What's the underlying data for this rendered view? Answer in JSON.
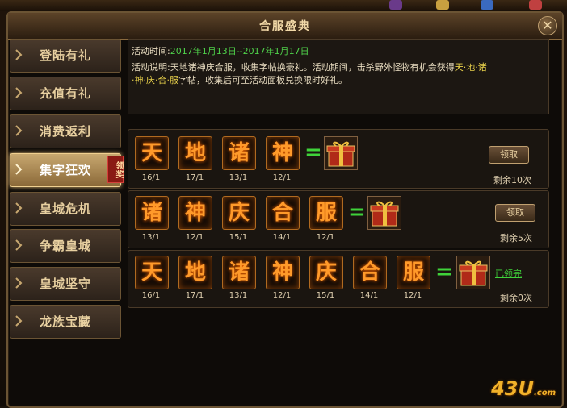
{
  "window": {
    "title": "合服盛典"
  },
  "sidebar": {
    "tabs": [
      {
        "label": "登陆有礼"
      },
      {
        "label": "充值有礼"
      },
      {
        "label": "消费返利"
      },
      {
        "label": "集字狂欢",
        "badge": "领奖"
      },
      {
        "label": "皇城危机"
      },
      {
        "label": "争霸皇城"
      },
      {
        "label": "皇城坚守"
      },
      {
        "label": "龙族宝藏"
      }
    ]
  },
  "info": {
    "time_label": "活动时间:",
    "time_value": "2017年1月13日--2017年1月17日",
    "desc_label": "活动说明:",
    "desc_1": "天地诸神庆合服，收集字帖换豪礼。活动期间，击杀野外怪物有机会获得",
    "desc_chars_1": "天·地·诸",
    "desc_chars_2": "·神·庆·合·服",
    "desc_2": "字帖，收集后可至活动面板兑换限时好礼。"
  },
  "rows": [
    {
      "chars": [
        "天",
        "地",
        "诸",
        "神"
      ],
      "counts": [
        "16/1",
        "17/1",
        "13/1",
        "12/1"
      ],
      "button": "领取",
      "remain": "剩余10次"
    },
    {
      "chars": [
        "诸",
        "神",
        "庆",
        "合",
        "服"
      ],
      "counts": [
        "13/1",
        "12/1",
        "15/1",
        "14/1",
        "12/1"
      ],
      "button": "领取",
      "remain": "剩余5次"
    },
    {
      "chars": [
        "天",
        "地",
        "诸",
        "神",
        "庆",
        "合",
        "服"
      ],
      "counts": [
        "16/1",
        "17/1",
        "13/1",
        "12/1",
        "15/1",
        "14/1",
        "12/1"
      ],
      "status": "已领完",
      "remain": "剩余0次"
    }
  ],
  "equals": "=",
  "logo": {
    "main": "43U",
    "suffix": ".com"
  },
  "colors": {
    "accent_gold": "#f2d9a8",
    "tile_text": "#ff9a2a",
    "green": "#3fd23a"
  }
}
